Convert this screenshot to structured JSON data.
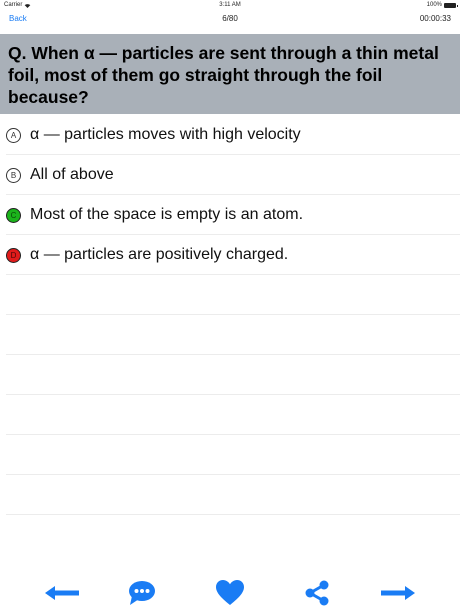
{
  "status_bar": {
    "carrier": "Carrier",
    "time": "3:11 AM",
    "battery_text": "100%",
    "battery_level": 1.0
  },
  "nav": {
    "back_label": "Back",
    "progress": "6/80",
    "timer": "00:00:33"
  },
  "question": {
    "text": "Q. When α — particles are sent through a thin metal foil, most of them go straight through the foil because?"
  },
  "answers": [
    {
      "letter": "A",
      "text": "α — particles moves with high velocity",
      "state": "neutral"
    },
    {
      "letter": "B",
      "text": "All of above",
      "state": "neutral"
    },
    {
      "letter": "C",
      "text": "Most of the space is empty is an atom.",
      "state": "correct"
    },
    {
      "letter": "D",
      "text": "α — particles are positively charged.",
      "state": "wrong"
    }
  ],
  "toolbar": {
    "icons": [
      "arrow-left-icon",
      "chat-bubble-icon",
      "heart-icon",
      "share-icon",
      "arrow-right-icon"
    ]
  },
  "colors": {
    "accent": "#1a7cf4",
    "question_band": "#a9b0b8",
    "correct": "#1bb31b",
    "wrong": "#e01b1b"
  }
}
